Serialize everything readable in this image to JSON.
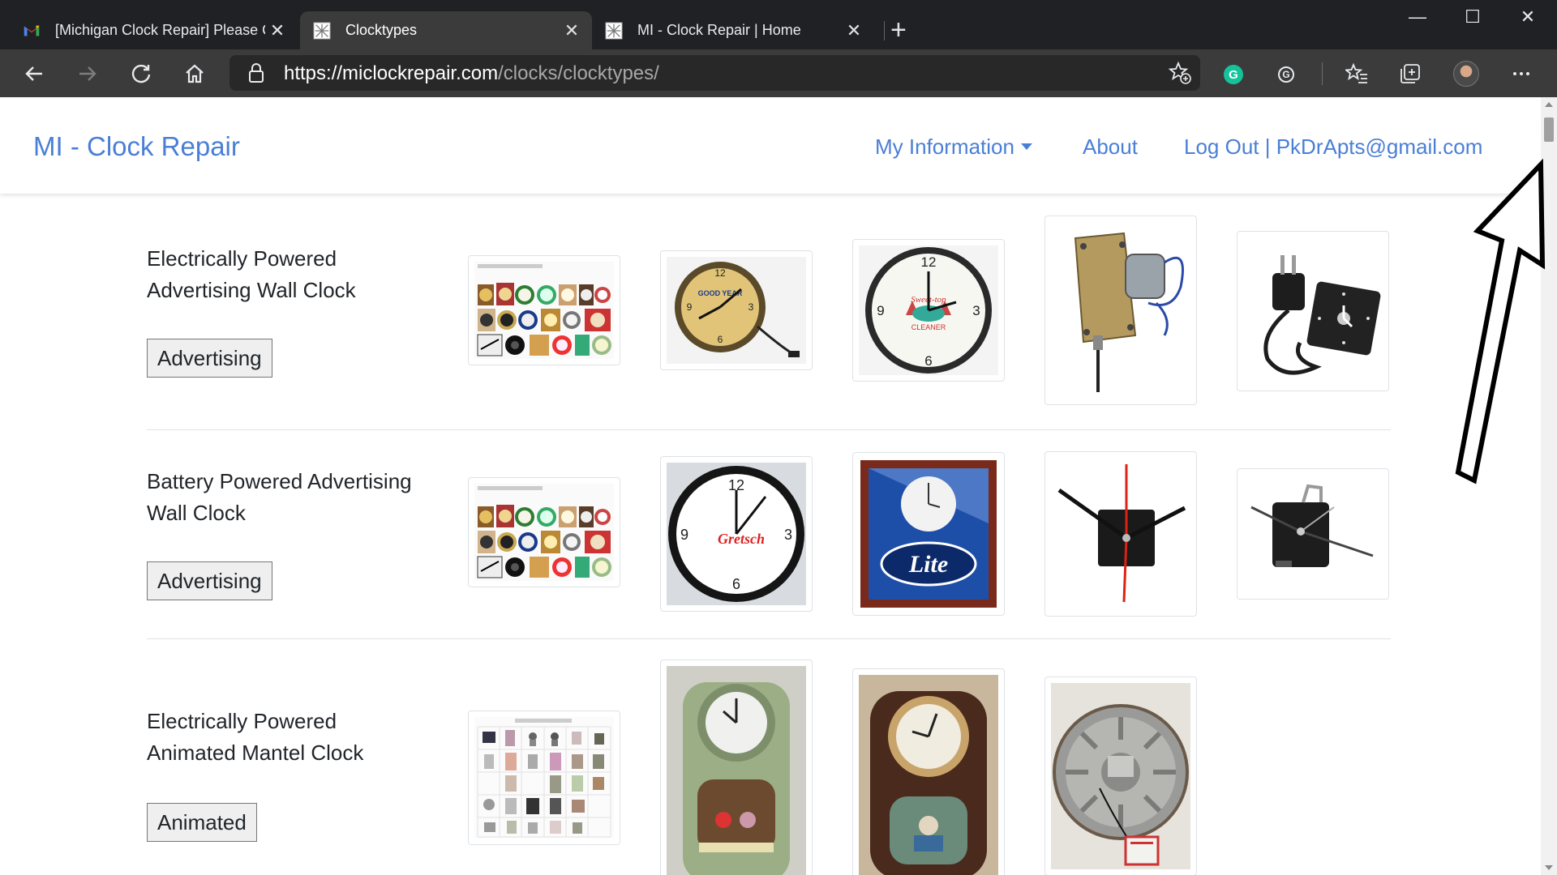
{
  "browser": {
    "tabs": [
      {
        "title": "[Michigan Clock Repair] Please C",
        "icon": "gmail-icon",
        "active": false
      },
      {
        "title": "Clocktypes",
        "icon": "site-icon",
        "active": true
      },
      {
        "title": "MI - Clock Repair | Home",
        "icon": "site-icon",
        "active": false
      }
    ],
    "url_domain": "https://miclockrepair.com",
    "url_path": "/clocks/clocktypes/"
  },
  "navbar": {
    "brand": "MI - Clock Repair",
    "my_information": "My Information",
    "about": "About",
    "logout": "Log Out | PkDrApts@gmail.com"
  },
  "rows": [
    {
      "label_line1": "Electrically Powered",
      "label_line2": "Advertising Wall Clock",
      "button": "Advertising",
      "images": [
        "advertising-collage",
        "goodyear-wall-clock",
        "sweet-top-cleaner-clock",
        "electric-clock-movement",
        "plug-in-clock-movement"
      ]
    },
    {
      "label_line1": "Battery Powered Advertising",
      "label_line2": "Wall Clock",
      "button": "Advertising",
      "images": [
        "advertising-collage",
        "gretsch-wall-clock",
        "miller-lite-clock",
        "quartz-movement-red-hand",
        "quartz-movement-side"
      ]
    },
    {
      "label_line1": "Electrically Powered",
      "label_line2": "Animated Mantel Clock",
      "button": "Animated",
      "images": [
        "animated-collage",
        "green-animated-mantel-clock",
        "brown-animated-mantel-clock",
        "animated-clock-motor"
      ]
    }
  ],
  "colors": {
    "link": "#4a7fd6",
    "chrome_dark": "#202124",
    "chrome_toolbar": "#3b3b3b"
  }
}
